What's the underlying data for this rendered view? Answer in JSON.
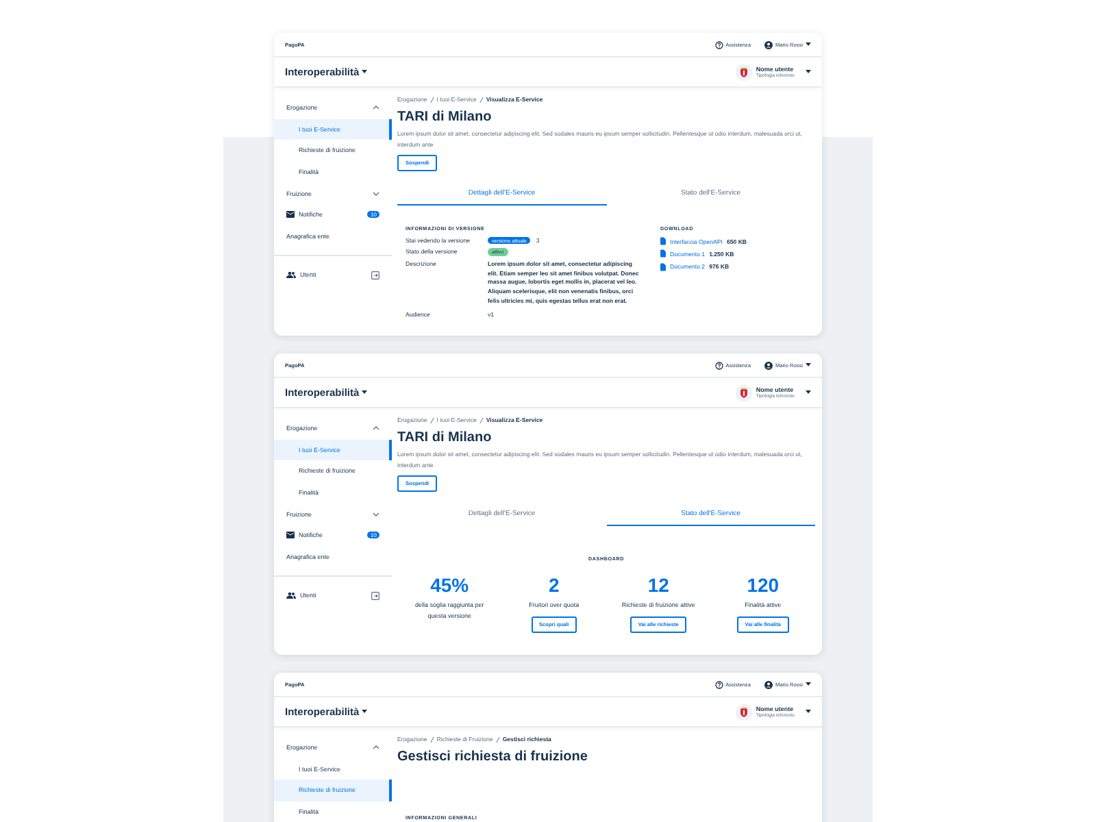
{
  "screens": [
    {
      "topbar": {
        "brand": "PagoPA",
        "help": "Assistenza",
        "user": "Mario Rossi"
      },
      "header": {
        "product": "Interoperabilità",
        "user_name": "Nome utente",
        "user_role": "Tipologia referente"
      },
      "sidebar": [
        {
          "kind": "group",
          "label": "Erogazione",
          "expanded": true
        },
        {
          "kind": "subitem",
          "label": "I tuoi E-Service",
          "selected": true
        },
        {
          "kind": "subitem",
          "label": "Richieste di fruizione",
          "selected": false
        },
        {
          "kind": "subitem",
          "label": "Finalità",
          "selected": false
        },
        {
          "kind": "group",
          "label": "Fruizione",
          "expanded": false
        },
        {
          "kind": "notify",
          "label": "Notifiche",
          "badge": "10"
        },
        {
          "kind": "link",
          "label": "Anagrafica ente"
        },
        {
          "kind": "users",
          "label": "Utenti"
        }
      ],
      "breadcrumb": [
        "Erogazione",
        "I tuoi E-Service",
        "Visualizza E-Service"
      ],
      "title": "TARI di Milano",
      "description": "Lorem ipsum dolor sit amet, consectetur adipiscing elit. Sed sodales mauris eu ipsum semper sollicitudin. Pellentesque ut odio interdum, malesuada orci ut, interdum ante",
      "action": "Sospendi",
      "tabs": [
        {
          "label": "Dettagli dell'E-Service",
          "selected": true
        },
        {
          "label": "Stato dell'E-Service",
          "selected": false
        }
      ],
      "panel": {
        "kind": "details",
        "heading": "INFORMAZIONI DI VERSIONE",
        "rows": [
          {
            "label": "Stai vedendo la versione",
            "chips": [
              {
                "text": "versione attuale",
                "color": "#0073e6"
              }
            ],
            "value": "3"
          },
          {
            "label": "Stato della versione",
            "chips": [
              {
                "text": "attivo",
                "color": "#6fcf97"
              }
            ]
          },
          {
            "label": "Descrizione",
            "value": "Lorem ipsum dolor sit amet, consectetur adipiscing elit. Etiam semper leo sit amet finibus volutpat. Donec massa augue, lobortis eget mollis in, placerat vel leo. Aliquam scelerisque, elit non venenatis finibus, orci felis ultricies mi, quis egestas tellus erat non erat.",
            "bold": true
          },
          {
            "label": "Audience",
            "value": "v1"
          }
        ],
        "download_heading": "DOWNLOAD",
        "files": [
          {
            "name": "Interfaccia OpenAPI",
            "size": "650 KB"
          },
          {
            "name": "Documento 1",
            "size": "1.250 KB"
          },
          {
            "name": "Documento 2",
            "size": "976 KB"
          }
        ]
      }
    },
    {
      "topbar": {
        "brand": "PagoPA",
        "help": "Assistenza",
        "user": "Mario Rossi"
      },
      "header": {
        "product": "Interoperabilità",
        "user_name": "Nome utente",
        "user_role": "Tipologia referente"
      },
      "sidebar": [
        {
          "kind": "group",
          "label": "Erogazione",
          "expanded": true
        },
        {
          "kind": "subitem",
          "label": "I tuoi E-Service",
          "selected": true
        },
        {
          "kind": "subitem",
          "label": "Richieste di fruizione",
          "selected": false
        },
        {
          "kind": "subitem",
          "label": "Finalità",
          "selected": false
        },
        {
          "kind": "group",
          "label": "Fruizione",
          "expanded": false
        },
        {
          "kind": "notify",
          "label": "Notifiche",
          "badge": "10"
        },
        {
          "kind": "link",
          "label": "Anagrafica ente"
        },
        {
          "kind": "users",
          "label": "Utenti"
        }
      ],
      "breadcrumb": [
        "Erogazione",
        "I tuoi E-Service",
        "Visualizza E-Service"
      ],
      "title": "TARI di Milano",
      "description": "Lorem ipsum dolor sit amet, consectetur adipiscing elit. Sed sodales mauris eu ipsum semper sollicitudin. Pellentesque ut odio interdum, malesuada orci ut, interdum ante",
      "action": "Sospendi",
      "tabs": [
        {
          "label": "Dettagli dell'E-Service",
          "selected": false
        },
        {
          "label": "Stato dell'E-Service",
          "selected": true
        }
      ],
      "panel": {
        "kind": "dashboard",
        "heading": "DASHBOARD",
        "stats": [
          {
            "value": "45%",
            "label": "della soglia raggiunta per questa versione"
          },
          {
            "value": "2",
            "label": "Fruitori over quota",
            "button": "Scopri quali"
          },
          {
            "value": "12",
            "label": "Richieste di fruizione attive",
            "button": "Vai alle richieste"
          },
          {
            "value": "120",
            "label": "Finalità attive",
            "button": "Vai alle finalità"
          }
        ]
      }
    },
    {
      "topbar": {
        "brand": "PagoPA",
        "help": "Assistenza",
        "user": "Mario Rossi"
      },
      "header": {
        "product": "Interoperabilità",
        "user_name": "Nome utente",
        "user_role": "Tipologia referente"
      },
      "sidebar": [
        {
          "kind": "group",
          "label": "Erogazione",
          "expanded": true
        },
        {
          "kind": "subitem",
          "label": "I tuoi E-Service",
          "selected": false
        },
        {
          "kind": "subitem",
          "label": "Richieste di fruizione",
          "selected": true
        },
        {
          "kind": "subitem",
          "label": "Finalità",
          "selected": false
        }
      ],
      "breadcrumb": [
        "Erogazione",
        "Richieste di Fruizione",
        "Gestisci richiesta"
      ],
      "title": "Gestisci richiesta di fruizione",
      "panel": {
        "kind": "section",
        "heading": "INFORMAZIONI GENERALI"
      }
    }
  ]
}
